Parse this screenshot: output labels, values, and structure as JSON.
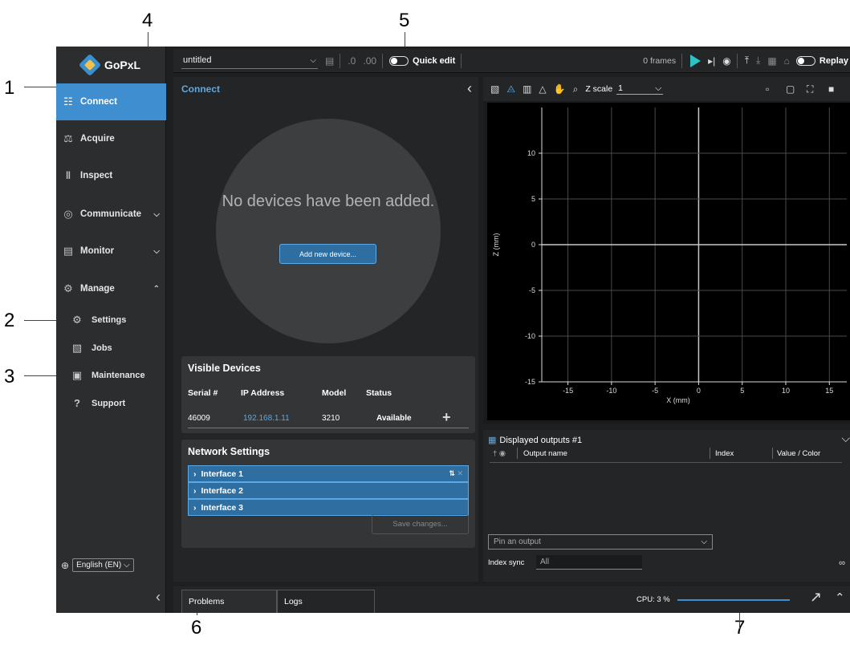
{
  "callouts": [
    "1",
    "2",
    "3",
    "4",
    "5",
    "6",
    "7"
  ],
  "sidebar": {
    "brand": "GoPxL",
    "items": [
      {
        "label": "Connect",
        "icon": "network-icon"
      },
      {
        "label": "Acquire",
        "icon": "acquire-icon"
      },
      {
        "label": "Inspect",
        "icon": "inspect-icon"
      },
      {
        "label": "Communicate",
        "icon": "globe-icon"
      },
      {
        "label": "Monitor",
        "icon": "clipboard-icon"
      },
      {
        "label": "Manage",
        "icon": "gears-icon"
      }
    ],
    "sub_items": [
      {
        "label": "Settings",
        "icon": "gear-icon"
      },
      {
        "label": "Jobs",
        "icon": "file-icon"
      },
      {
        "label": "Maintenance",
        "icon": "toolbox-icon"
      },
      {
        "label": "Support",
        "icon": "help-icon"
      }
    ],
    "language": "English (EN)"
  },
  "toolbar": {
    "file_name": "untitled",
    "quick_edit_label": "Quick edit",
    "frames": "0 frames",
    "replay_label": "Replay"
  },
  "connect": {
    "title": "Connect",
    "empty_message": "No devices have been added.",
    "add_device_label": "Add new device...",
    "visible_devices": {
      "title": "Visible Devices",
      "columns": [
        "Serial #",
        "IP Address",
        "Model",
        "Status"
      ],
      "rows": [
        {
          "serial": "46009",
          "ip": "192.168.1.11",
          "model": "3210",
          "status": "Available"
        }
      ]
    },
    "network": {
      "title": "Network Settings",
      "interfaces": [
        "Interface 1",
        "Interface 2",
        "Interface 3"
      ],
      "save_label": "Save changes..."
    }
  },
  "plot": {
    "zscale_label": "Z scale",
    "zscale_value": "1",
    "xlabel": "X (mm)",
    "ylabel": "Z (mm)",
    "x_ticks": [
      "-15",
      "-10",
      "-5",
      "0",
      "5",
      "10",
      "15"
    ],
    "y_ticks": [
      "10",
      "5",
      "0",
      "-5",
      "-10",
      "-15"
    ]
  },
  "outputs": {
    "title": "Displayed outputs #1",
    "columns": [
      "Output name",
      "Index",
      "Value / Color"
    ],
    "pin_placeholder": "Pin an output",
    "index_sync_label": "Index sync",
    "index_sync_value": "All"
  },
  "bottombar": {
    "tabs": [
      "Problems",
      "Logs"
    ],
    "cpu_label": "CPU: 3 %",
    "cpu_fraction": 0.03
  },
  "colors": {
    "accent": "#3e8ed0",
    "play": "#2fc2c4",
    "panel": "#232527",
    "sidebar": "#2b2d2f"
  }
}
